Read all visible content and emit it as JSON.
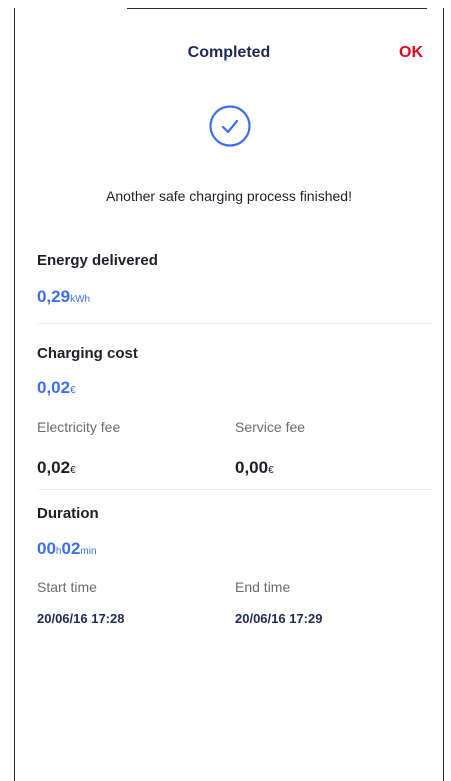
{
  "header": {
    "title": "Completed",
    "ok_label": "OK"
  },
  "status": {
    "icon": "check-circle-icon",
    "message": "Another safe charging  process finished!"
  },
  "energy": {
    "title": "Energy delivered",
    "value": "0,29",
    "unit": "kWh"
  },
  "cost": {
    "title": "Charging cost",
    "value": "0,02",
    "unit": "€",
    "electricity_label": "Electricity fee",
    "electricity_value": "0,02",
    "electricity_unit": "€",
    "service_label": "Service fee",
    "service_value": "0,00",
    "service_unit": "€"
  },
  "duration": {
    "title": "Duration",
    "hours": "00",
    "hours_unit": "h",
    "minutes": "02",
    "minutes_unit": "min",
    "start_label": "Start time",
    "start_value": "20/06/16 17:28",
    "end_label": "End time",
    "end_value": "20/06/16 17:29"
  },
  "colors": {
    "accent_blue": "#3d6ff0",
    "ok_red": "#e3071a",
    "title_navy": "#1f2a55"
  }
}
